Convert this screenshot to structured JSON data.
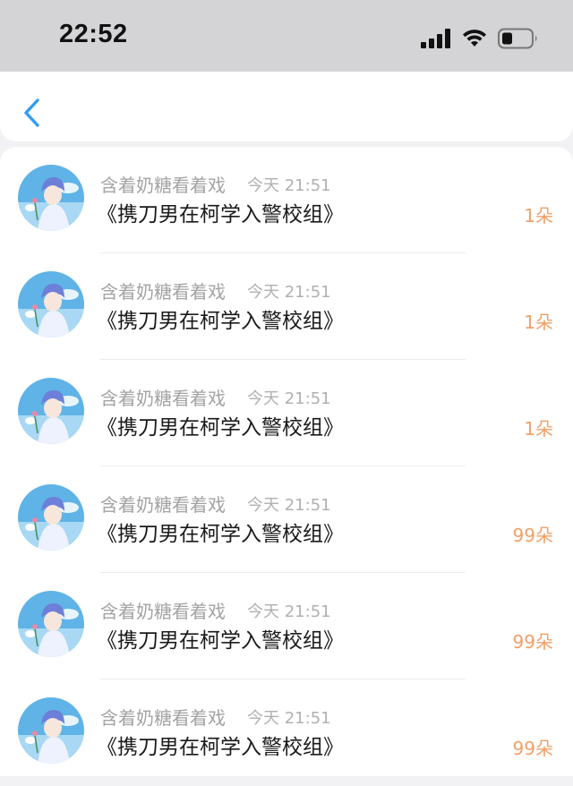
{
  "status_bar": {
    "time": "22:52",
    "icons": [
      "cellular-signal-icon",
      "wifi-icon",
      "battery-icon"
    ]
  },
  "nav": {
    "back_icon": "chevron-left-icon",
    "accent_color": "#2f9df4"
  },
  "colors": {
    "gift_count": "#f0a067",
    "title": "#1a1a1a",
    "meta": "#a3a3a3"
  },
  "items": [
    {
      "user": "含着奶糖看着戏",
      "time": "今天 21:51",
      "title": "《携刀男在柯学入警校组》",
      "count": "1朵"
    },
    {
      "user": "含着奶糖看着戏",
      "time": "今天 21:51",
      "title": "《携刀男在柯学入警校组》",
      "count": "1朵"
    },
    {
      "user": "含着奶糖看着戏",
      "time": "今天 21:51",
      "title": "《携刀男在柯学入警校组》",
      "count": "1朵"
    },
    {
      "user": "含着奶糖看着戏",
      "time": "今天 21:51",
      "title": "《携刀男在柯学入警校组》",
      "count": "99朵"
    },
    {
      "user": "含着奶糖看着戏",
      "time": "今天 21:51",
      "title": "《携刀男在柯学入警校组》",
      "count": "99朵"
    },
    {
      "user": "含着奶糖看着戏",
      "time": "今天 21:51",
      "title": "《携刀男在柯学入警校组》",
      "count": "99朵"
    }
  ]
}
